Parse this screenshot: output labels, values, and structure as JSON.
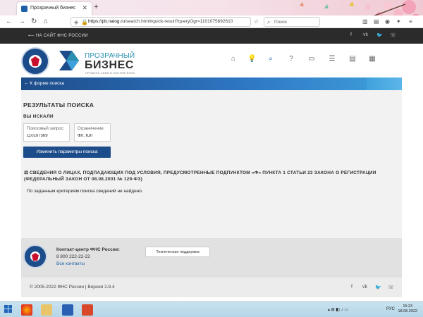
{
  "browser": {
    "tab_title": "Прозрачный бизнес",
    "tab_close": "✕",
    "new_tab": "+",
    "url_host": "https://pb.nalog.ru",
    "url_path": "/search.html#quick-result?queryOgr=1101075692610",
    "search_placeholder": "Поиск"
  },
  "site_top": {
    "back_link": "НА САЙТ ФНС РОССИИ"
  },
  "brand": {
    "line1": "ПРОЗРАЧНЫЙ",
    "line2": "БИЗНЕС",
    "tagline": "ПРОВЕРЬ СЕБЯ И КОНТРАГЕНТА"
  },
  "header_icons": [
    "home-icon",
    "bulb-icon",
    "search-icon",
    "help-icon",
    "chat-icon",
    "database-icon",
    "list-icon",
    "table-icon"
  ],
  "breadcrumb": {
    "back_label": "← К форме поиска"
  },
  "results": {
    "title": "РЕЗУЛЬТАТЫ ПОИСКА",
    "searched_heading": "ВЫ ИСКАЛИ",
    "query_label": "Поисковый запрос:",
    "query_value": "110107569",
    "restriction_label": "Ограничение:",
    "restriction_value": "ФЛ, ЮЛ",
    "change_button": "Изменить параметры поиска",
    "section_title": "СВЕДЕНИЯ О ЛИЦАХ, ПОДПАДАЮЩИХ ПОД УСЛОВИЯ, ПРЕДУСМОТРЕННЫЕ ПОДПУНКТОМ «Ф» ПУНКТА 1 СТАТЬИ 23 ЗАКОНА О РЕГИСТРАЦИИ (ФЕДЕРАЛЬНЫЙ ЗАКОН ОТ 08.08.2001 № 129-ФЗ)",
    "not_found": "По заданным критериям поиска сведений не найдено."
  },
  "footer": {
    "contact_title": "Контакт-центр ФНС России:",
    "phone": "8 800 222-22-22",
    "all_contacts": "Все контакты",
    "tech_support": "Техническая поддержка",
    "copyright": "© 2005-2022 ФНС России   |   Версия 2.8.4"
  },
  "taskbar": {
    "lang": "РУС",
    "time": "15:23",
    "date": "18.08.2022"
  },
  "colors": {
    "primary": "#1d4c8a",
    "accent": "#2a8fb0",
    "dark_strip": "#2b2b2b"
  }
}
